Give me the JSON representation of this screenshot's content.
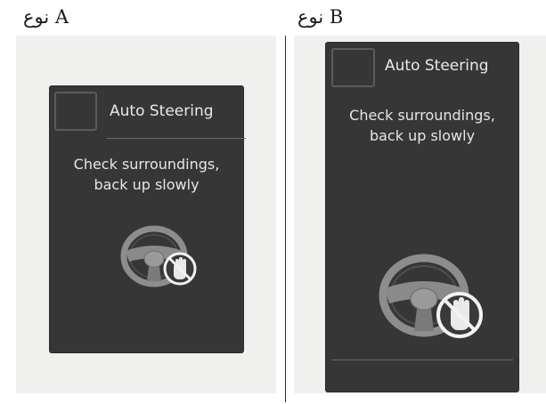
{
  "panel_a": {
    "type_label": "نوع A",
    "screen": {
      "title": "Auto Steering",
      "message_lines": [
        "Check surroundings,",
        "back up slowly"
      ]
    }
  },
  "panel_b": {
    "type_label": "نوع B",
    "screen": {
      "title": "Auto Steering",
      "message_lines": [
        "Check surroundings,",
        "back up slowly"
      ]
    }
  },
  "icons": {
    "wheel": "steering-wheel-icon",
    "hand_prohibited": "hands-off-icon"
  },
  "colors": {
    "screen_background": "#363636",
    "panel_background": "#f0f0ef",
    "screen_text": "#e6e6e6"
  }
}
